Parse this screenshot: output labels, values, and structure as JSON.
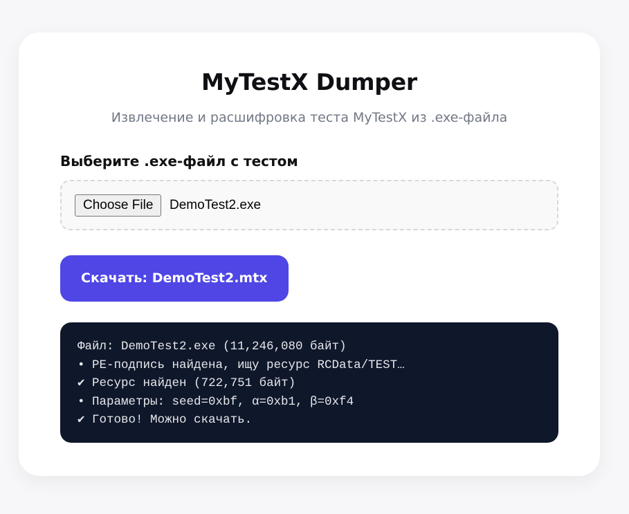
{
  "app": {
    "title": "MyTestX Dumper",
    "subtitle": "Извлечение и расшифровка теста MyTestX из .exe-файла"
  },
  "file_picker": {
    "label": "Выберите .exe-файл с тестом",
    "button_label": "Choose File",
    "selected_file": "DemoTest2.exe"
  },
  "download_button": {
    "label": "Скачать: DemoTest2.mtx"
  },
  "log": {
    "lines": [
      "Файл: DemoTest2.exe (11,246,080 байт)",
      "• PE-подпись найдена, ищу ресурс RCData/TEST…",
      "✔ Ресурс найден (722,751 байт)",
      "• Параметры: seed=0xbf, α=0xb1, β=0xf4",
      "✔ Готово! Можно скачать."
    ]
  },
  "colors": {
    "accent": "#4f46e5",
    "log_background": "#0f172a",
    "log_text": "#e5e7eb"
  }
}
